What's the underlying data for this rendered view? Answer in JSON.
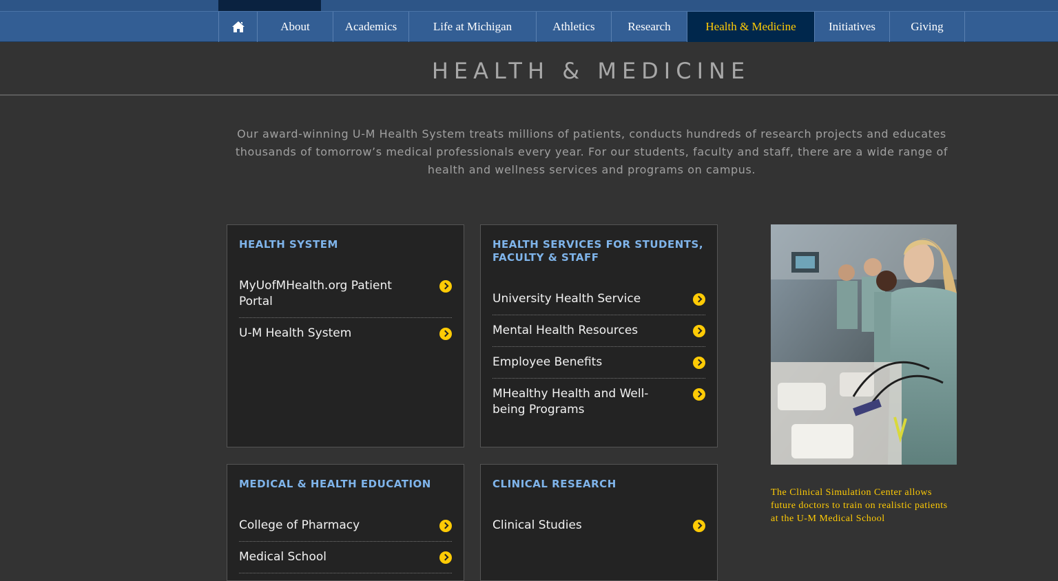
{
  "nav": {
    "home_icon": "home-icon",
    "items": [
      {
        "label": "About"
      },
      {
        "label": "Academics"
      },
      {
        "label": "Life at Michigan"
      },
      {
        "label": "Athletics"
      },
      {
        "label": "Research"
      },
      {
        "label": "Health & Medicine",
        "active": true
      },
      {
        "label": "Initiatives"
      },
      {
        "label": "Giving"
      }
    ]
  },
  "page": {
    "title": "HEALTH & MEDICINE",
    "intro": "Our award-winning U-M Health System treats millions of patients, conducts hundreds of research projects and educates thousands of tomorrow’s medical professionals every year. For our students, faculty and staff, there are a wide range of health and wellness services and programs on campus."
  },
  "cards": {
    "health_system": {
      "heading": "HEALTH SYSTEM",
      "links": [
        "MyUofMHealth.org Patient Portal",
        "U-M Health System"
      ]
    },
    "health_services": {
      "heading": "HEALTH SERVICES FOR STUDENTS, FACULTY & STAFF",
      "links": [
        "University Health Service",
        "Mental Health Resources",
        "Employee Benefits",
        "MHealthy Health and Well-being Programs"
      ]
    },
    "education": {
      "heading": "MEDICAL & HEALTH EDUCATION",
      "links": [
        "College of Pharmacy",
        "Medical School"
      ]
    },
    "clinical": {
      "heading": "CLINICAL RESEARCH",
      "links": [
        "Clinical Studies"
      ]
    }
  },
  "feature": {
    "caption": "The Clinical Simulation Center allows future doctors to train on realistic patients at the U-M Medical School"
  },
  "colors": {
    "nav_bg": "#335e94",
    "nav_active_bg": "#00274c",
    "maize": "#ffcb05",
    "heading_blue": "#7fb4ea",
    "page_bg": "#333333"
  }
}
